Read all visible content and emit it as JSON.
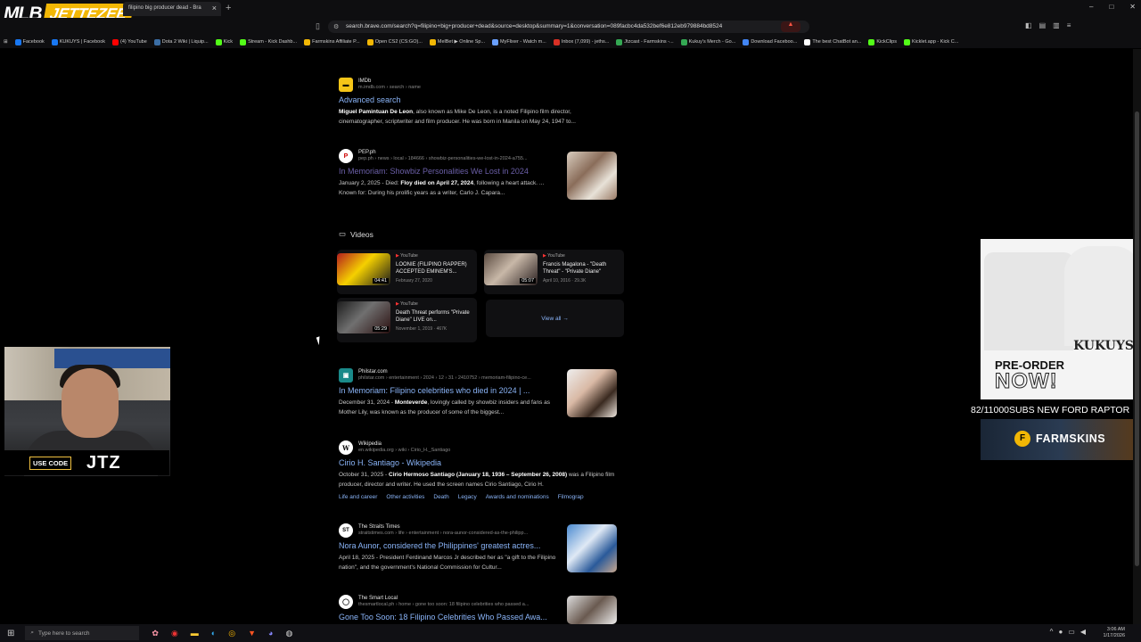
{
  "browser": {
    "logo_text_mlb": "MLB",
    "logo_text_jet": "JETTEZEE",
    "tab_title": "filipino big producer dead - Bra",
    "url": "search.brave.com/search?q=filipino+big+producer+dead&source=desktop&summary=1&conversation=089facbc4da532bef6e812eb979884bd8524",
    "window_controls": [
      "–",
      "□",
      "✕"
    ],
    "bookmarks": [
      {
        "label": "Facebook",
        "color": "#1877f2"
      },
      {
        "label": "KUKUYS | Facebook",
        "color": "#1877f2"
      },
      {
        "label": "(4) YouTube",
        "color": "#ff0000"
      },
      {
        "label": "Dota 2 Wiki | Liquip...",
        "color": "#3b6ea5"
      },
      {
        "label": "Kick",
        "color": "#53fc18"
      },
      {
        "label": "Stream - Kick Dashb...",
        "color": "#53fc18"
      },
      {
        "label": "Farmskins Affiliate P...",
        "color": "#f2b705"
      },
      {
        "label": "Open CS2 (CS:GO)...",
        "color": "#f2b705"
      },
      {
        "label": "MelBet ▶ Online Sp...",
        "color": "#f2b705"
      },
      {
        "label": "MyFlixer - Watch m...",
        "color": "#6aa0ff"
      },
      {
        "label": "Inbox (7,099) - jeths...",
        "color": "#d93025"
      },
      {
        "label": "Jtzcast - Farmskins -...",
        "color": "#34a853"
      },
      {
        "label": "Kukuy's Merch - Go...",
        "color": "#34a853"
      },
      {
        "label": "Download Faceboo...",
        "color": "#4285f4"
      },
      {
        "label": "The best ChatBot an...",
        "color": "#ffffff"
      },
      {
        "label": "KickClips",
        "color": "#53fc18"
      },
      {
        "label": "Kicklet.app - Kick C...",
        "color": "#53fc18"
      }
    ]
  },
  "results": [
    {
      "source": "IMDb",
      "url": "m.imdb.com › search › name",
      "title": "Advanced search",
      "desc_bold": "Miguel Pamintuan De Leon",
      "desc": ", also known as Mike De Leon, is a noted Filipino film director, cinematographer, scriptwriter and film producer. He was born in Manila on May 24, 1947 to..."
    },
    {
      "source": "PEP.ph",
      "url": "pep.ph › news › local › 184666 › showbiz-personalities-we-lost-in-2024-a755...",
      "title": "In Memoriam: Showbiz Personalities We Lost in 2024",
      "date": "January 2, 2025 - Died: ",
      "desc_bold": "Floy died on April 27, 2024",
      "desc": ", following a heart attack. ... Known for: During his prolific years as a writer, Carlo J. Capara..."
    },
    {
      "source": "Philstar.com",
      "url": "philstar.com › entertainment › 2024 › 12 › 31 › 2410752 › memoriam-filipino-ce...",
      "title": "In Memoriam: Filipino celebrities who died in 2024 | ...",
      "date": "December 31, 2024 - ",
      "desc_bold": "Monteverde",
      "desc": ", lovingly called by showbiz insiders and fans as Mother Lily, was known as the producer of some of the biggest..."
    },
    {
      "source": "Wikipedia",
      "url": "en.wikipedia.org › wiki › Cirio_H._Santiago",
      "title": "Cirio H. Santiago - Wikipedia",
      "date": "October 31, 2025 - ",
      "desc_bold": "Cirio Hermoso Santiago (January 18, 1936 – September 26, 2008)",
      "desc": " was a Filipino film producer, director and writer. He used the screen names Cirio Santiago, Cirio H.",
      "sublinks": [
        "Life and career",
        "Other activities",
        "Death",
        "Legacy",
        "Awards and nominations",
        "Filmograp"
      ]
    },
    {
      "source": "The Straits Times",
      "url": "straitstimes.com › life › entertainment › nora-aunor-considered-as-the-philipp...",
      "title": "Nora Aunor, considered the Philippines' greatest actres...",
      "date": "April 18, 2025 - ",
      "desc": "President Ferdinand Marcos Jr described her as \"a gift to the Filipino nation\", and the government's National Commission for Cultur..."
    },
    {
      "source": "The Smart Local",
      "url": "thesmartlocal.ph › home › gone too soon: 18 filipino celebrities who passed a...",
      "title": "Gone Too Soon: 18 Filipino Celebrities Who Passed Awa..."
    }
  ],
  "videos": {
    "header": "Videos",
    "view_all": "View all",
    "items": [
      {
        "source": "YouTube",
        "title": "LOONIE (FILIPINO RAPPER) ACCEPTED EMINEM'S...",
        "date": "February 27, 2020",
        "views": "",
        "duration": "04:41"
      },
      {
        "source": "YouTube",
        "title": "Francis Magalona - \"Death Threat\" - \"Private Diane\"",
        "date": "April 10, 2016",
        "views": "29.3K",
        "duration": "05:07"
      },
      {
        "source": "YouTube",
        "title": "Death Threat performs \"Private Diane\" LIVE on...",
        "date": "November 1, 2019",
        "views": "467K",
        "duration": "05:29"
      }
    ]
  },
  "stream": {
    "code_label": "USE CODE",
    "code": "JTZ",
    "merch_brand": "KUKUYS",
    "merch_pre": "PRE-ORDER",
    "merch_now": "NOW!",
    "subs_goal": "82/11000SUBS NEW FORD RAPTOR",
    "sponsor": "FARMSKINS",
    "sponsor_coin": "F"
  },
  "taskbar": {
    "search_placeholder": "Type here to search",
    "time": "3:06 AM",
    "date": "1/17/2026"
  }
}
